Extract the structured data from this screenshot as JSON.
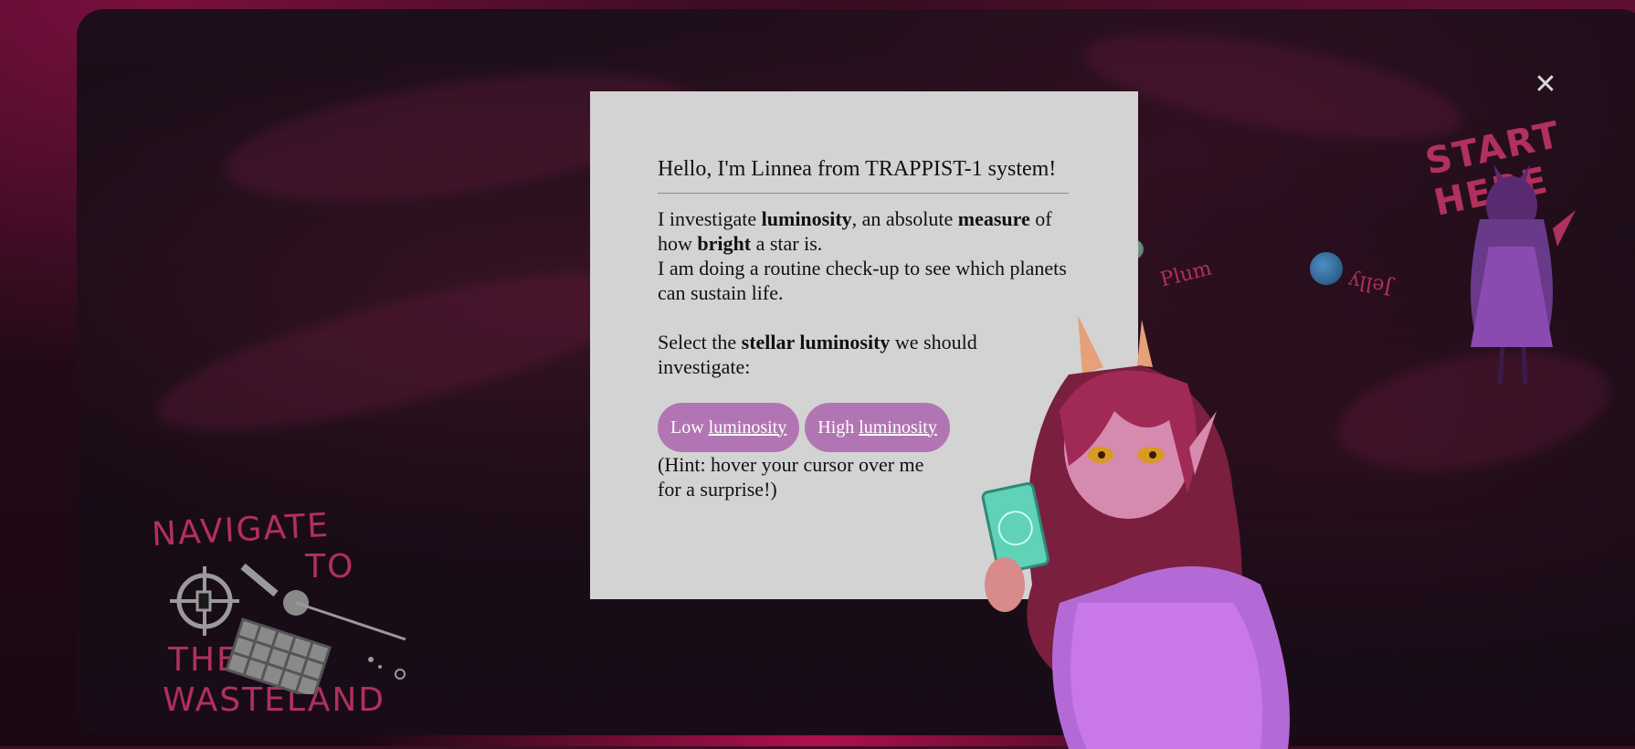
{
  "scene": {
    "start_label": "START HERE",
    "navigate_line1": "NAVIGATE",
    "navigate_line2": "TO",
    "navigate_line3": "THE",
    "navigate_line4": "WASTELAND",
    "planets": [
      {
        "label": "Plum",
        "color": "#6f8a86"
      },
      {
        "label": "Jelly",
        "color": "#2f6b9c"
      }
    ],
    "close_icon": "close-icon",
    "colors": {
      "accent_text": "#b0305e",
      "modal_bg": "#d3d3d3",
      "pill_bg": "#b275b3"
    }
  },
  "modal": {
    "title": "Hello, I'm Linnea from TRAPPIST-1 system!",
    "intro_1": "I investigate ",
    "intro_bold_1": "luminosity",
    "intro_2": ", an absolute ",
    "intro_bold_2": "measure",
    "intro_3": " of how ",
    "intro_bold_3": "bright",
    "intro_4": " a star is.",
    "intro_line2": "I am doing a routine check-up to see which planets can sustain life.",
    "prompt_1": "Select the ",
    "prompt_bold": "stellar luminosity",
    "prompt_2": " we should investigate:",
    "options": [
      {
        "prefix": "Low ",
        "link": "luminosity"
      },
      {
        "prefix": "High ",
        "link": "luminosity"
      }
    ],
    "hint": "(Hint: hover your cursor over me for a surprise!)"
  }
}
